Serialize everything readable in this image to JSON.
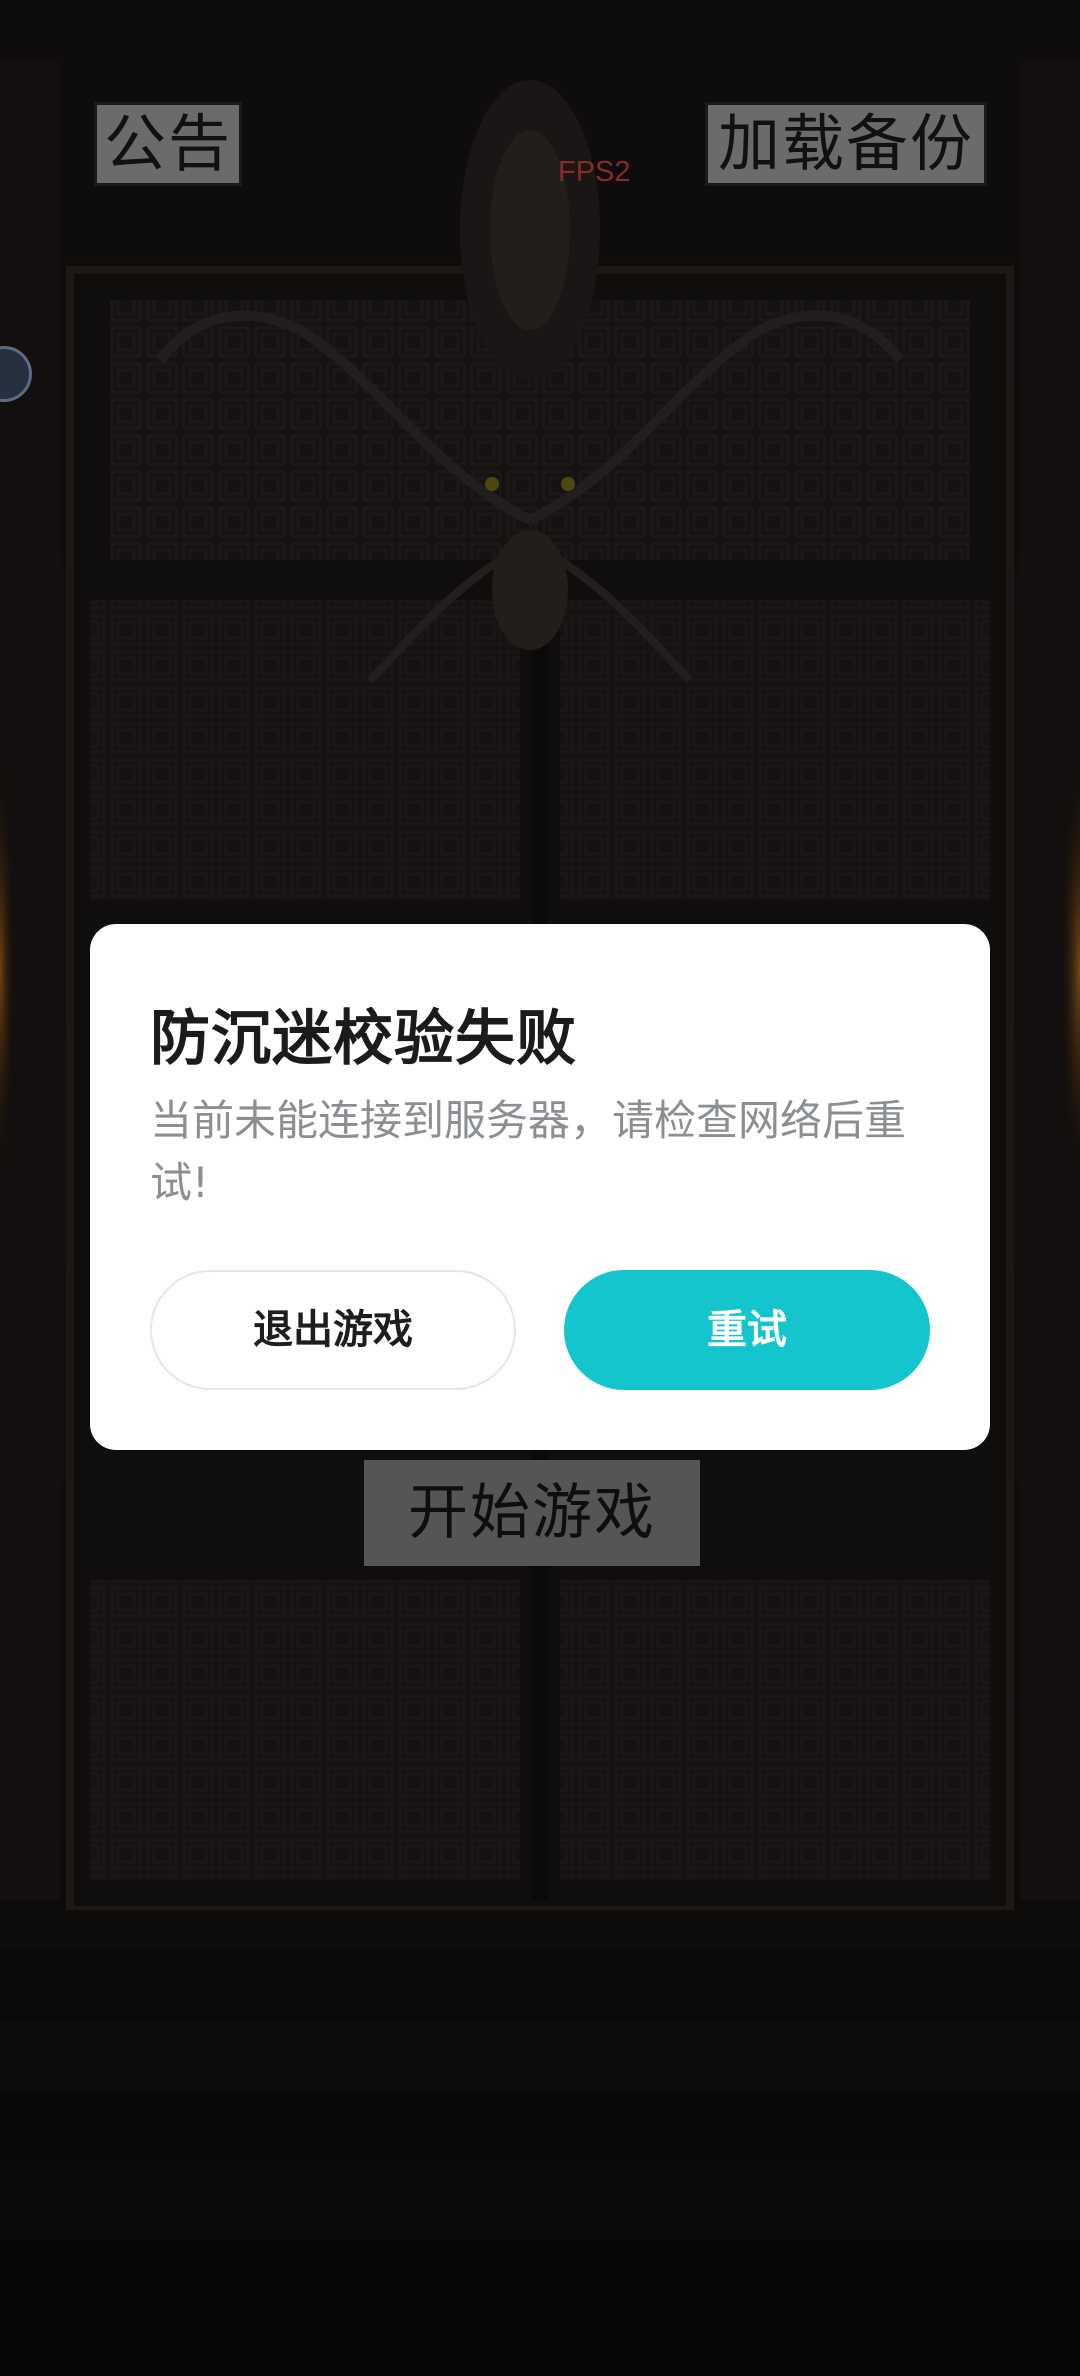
{
  "header": {
    "notice_label": "公告",
    "load_backup_label": "加载备份",
    "fps_text": "FPS2"
  },
  "main": {
    "start_label": "开始游戏"
  },
  "dialog": {
    "title": "防沉迷校验失败",
    "message": "当前未能连接到服务器，请检查网络后重试!",
    "exit_label": "退出游戏",
    "retry_label": "重试"
  },
  "colors": {
    "accent": "#14c5ce",
    "fps": "#8b2a24",
    "top_button_bg": "#6b6b6b",
    "start_button_bg": "#555555"
  },
  "icons": {
    "side_badge": "floating-assistant-icon"
  }
}
